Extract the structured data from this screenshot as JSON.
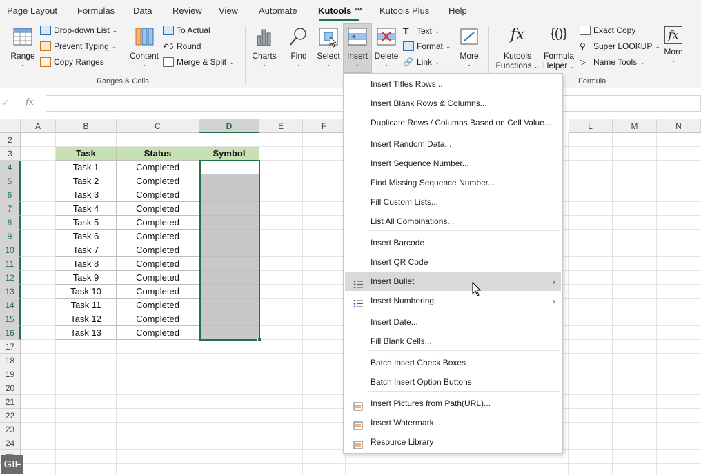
{
  "tabs": [
    "Page Layout",
    "Formulas",
    "Data",
    "Review",
    "View",
    "Automate",
    "Kutools ™",
    "Kutools Plus",
    "Help"
  ],
  "ribbon": {
    "range_label": "Range",
    "dropdown_list": "Drop-down List",
    "prevent_typing": "Prevent Typing",
    "copy_ranges": "Copy Ranges",
    "content_label": "Content",
    "to_actual": "To Actual",
    "round": "Round",
    "merge_split": "Merge & Split",
    "group_ranges": "Ranges & Cells",
    "charts": "Charts",
    "find": "Find",
    "select": "Select",
    "insert": "Insert",
    "delete": "Delete",
    "text": "Text",
    "format": "Format",
    "link": "Link",
    "more1": "More",
    "kutools_functions_1": "Kutools",
    "kutools_functions_2": "Functions",
    "formula_helper_1": "Formula",
    "formula_helper_2": "Helper",
    "exact_copy": "Exact Copy",
    "super_lookup": "Super LOOKUP",
    "name_tools": "Name Tools",
    "more2": "More",
    "group_formula": "Formula"
  },
  "formula_bar": {
    "fx": "fx",
    "check": "✓"
  },
  "columns": [
    "A",
    "B",
    "C",
    "D",
    "E",
    "F",
    "L",
    "M",
    "N"
  ],
  "rows": [
    "2",
    "3",
    "4",
    "5",
    "6",
    "7",
    "8",
    "9",
    "10",
    "11",
    "12",
    "13",
    "14",
    "15",
    "16",
    "17",
    "18",
    "19",
    "20",
    "21",
    "22",
    "23",
    "24",
    "25"
  ],
  "table": {
    "headers": [
      "Task",
      "Status",
      "Symbol"
    ],
    "rows": [
      [
        "Task 1",
        "Completed",
        ""
      ],
      [
        "Task 2",
        "Completed",
        ""
      ],
      [
        "Task 3",
        "Completed",
        ""
      ],
      [
        "Task 4",
        "Completed",
        ""
      ],
      [
        "Task 5",
        "Completed",
        ""
      ],
      [
        "Task 6",
        "Completed",
        ""
      ],
      [
        "Task 7",
        "Completed",
        ""
      ],
      [
        "Task 8",
        "Completed",
        ""
      ],
      [
        "Task 9",
        "Completed",
        ""
      ],
      [
        "Task 10",
        "Completed",
        ""
      ],
      [
        "Task 11",
        "Completed",
        ""
      ],
      [
        "Task 12",
        "Completed",
        ""
      ],
      [
        "Task 13",
        "Completed",
        ""
      ]
    ]
  },
  "menu": [
    {
      "label": "Insert Titles Rows..."
    },
    {
      "label": "Insert Blank Rows & Columns..."
    },
    {
      "label": "Duplicate Rows / Columns Based on Cell Value..."
    },
    {
      "label": "Insert Random Data..."
    },
    {
      "label": "Insert Sequence Number..."
    },
    {
      "label": "Find Missing Sequence Number..."
    },
    {
      "label": "Fill Custom Lists..."
    },
    {
      "label": "List All Combinations..."
    },
    {
      "label": "Insert Barcode"
    },
    {
      "label": "Insert QR Code"
    },
    {
      "label": "Insert Bullet"
    },
    {
      "label": "Insert Numbering"
    },
    {
      "label": "Insert Date..."
    },
    {
      "label": "Fill Blank Cells..."
    },
    {
      "label": "Batch Insert Check Boxes"
    },
    {
      "label": "Batch Insert Option Buttons"
    },
    {
      "label": "Insert Pictures from Path(URL)..."
    },
    {
      "label": "Insert Watermark..."
    },
    {
      "label": "Resource Library"
    }
  ],
  "gif_badge": "GIF",
  "colors": {
    "accent": "#217346",
    "header_fill": "#c6e0b4",
    "menu_highlight": "#d9d9d9"
  }
}
